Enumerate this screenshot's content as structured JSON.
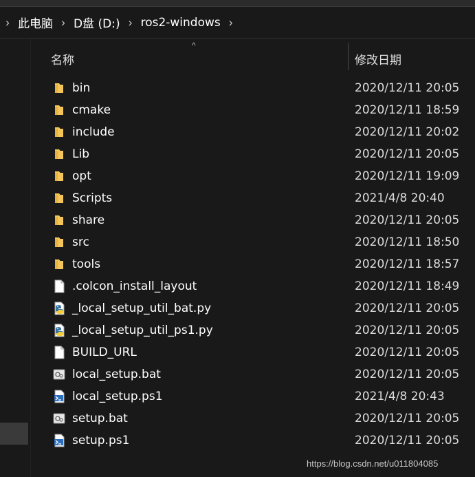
{
  "breadcrumb": {
    "items": [
      "此电脑",
      "D盘 (D:)",
      "ros2-windows"
    ],
    "separator": "›"
  },
  "columns": {
    "name": "名称",
    "date": "修改日期"
  },
  "files": [
    {
      "name": "bin",
      "date": "2020/12/11 20:05",
      "icon": "folder-icon"
    },
    {
      "name": "cmake",
      "date": "2020/12/11 18:59",
      "icon": "folder-icon"
    },
    {
      "name": "include",
      "date": "2020/12/11 20:02",
      "icon": "folder-icon"
    },
    {
      "name": "Lib",
      "date": "2020/12/11 20:05",
      "icon": "folder-icon"
    },
    {
      "name": "opt",
      "date": "2020/12/11 19:09",
      "icon": "folder-icon"
    },
    {
      "name": "Scripts",
      "date": "2021/4/8 20:40",
      "icon": "folder-icon"
    },
    {
      "name": "share",
      "date": "2020/12/11 20:05",
      "icon": "folder-icon"
    },
    {
      "name": "src",
      "date": "2020/12/11 18:50",
      "icon": "folder-icon"
    },
    {
      "name": "tools",
      "date": "2020/12/11 18:57",
      "icon": "folder-icon"
    },
    {
      "name": ".colcon_install_layout",
      "date": "2020/12/11 18:49",
      "icon": "file-icon"
    },
    {
      "name": "_local_setup_util_bat.py",
      "date": "2020/12/11 20:05",
      "icon": "python-file-icon"
    },
    {
      "name": "_local_setup_util_ps1.py",
      "date": "2020/12/11 20:05",
      "icon": "python-file-icon"
    },
    {
      "name": "BUILD_URL",
      "date": "2020/12/11 20:05",
      "icon": "file-icon"
    },
    {
      "name": "local_setup.bat",
      "date": "2020/12/11 20:05",
      "icon": "batch-file-icon"
    },
    {
      "name": "local_setup.ps1",
      "date": "2021/4/8 20:43",
      "icon": "powershell-file-icon"
    },
    {
      "name": "setup.bat",
      "date": "2020/12/11 20:05",
      "icon": "batch-file-icon"
    },
    {
      "name": "setup.ps1",
      "date": "2020/12/11 20:05",
      "icon": "powershell-file-icon"
    }
  ],
  "watermark": "https://blog.csdn.net/u011804085",
  "colors": {
    "background": "#191919",
    "folder": "#f3c55a",
    "text": "#ffffff"
  }
}
